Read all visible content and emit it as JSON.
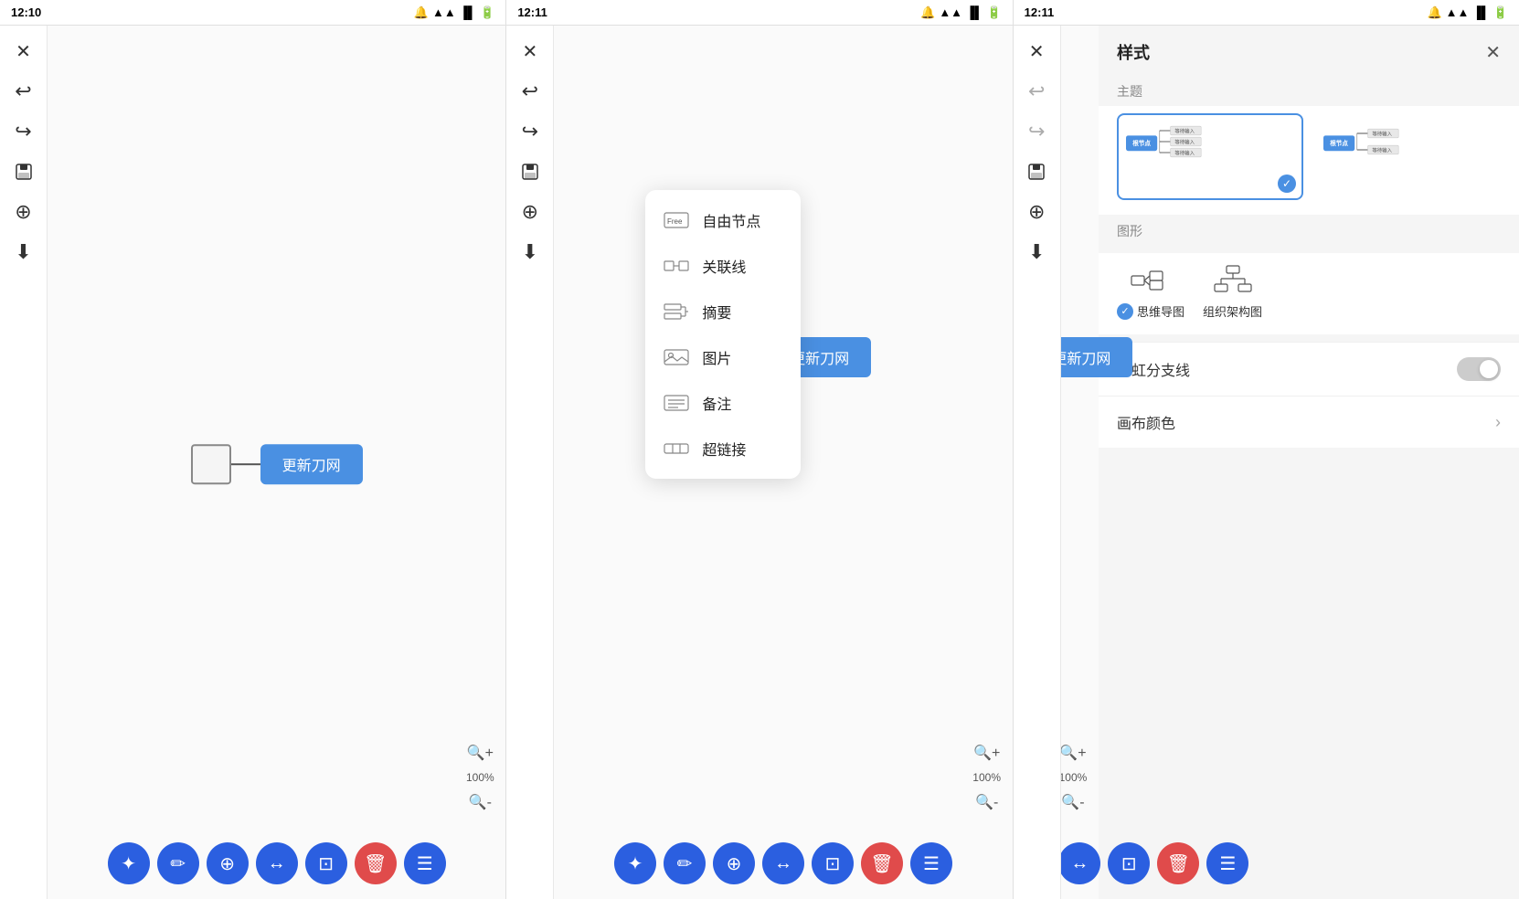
{
  "panels": [
    {
      "id": "panel1",
      "time": "12:10",
      "canvas_node_text": "更新刀网",
      "zoom": "100%"
    },
    {
      "id": "panel2",
      "time": "12:11",
      "canvas_node_text": "更新刀网",
      "zoom": "100%",
      "dropdown": {
        "items": [
          {
            "label": "自由节点",
            "icon": "free"
          },
          {
            "label": "关联线",
            "icon": "link"
          },
          {
            "label": "摘要",
            "icon": "summary"
          },
          {
            "label": "图片",
            "icon": "image"
          },
          {
            "label": "备注",
            "icon": "note"
          },
          {
            "label": "超链接",
            "icon": "hyperlink"
          }
        ]
      }
    },
    {
      "id": "panel3",
      "time": "12:11",
      "canvas_node_text": "更新刀网",
      "zoom": "100%",
      "style_panel": {
        "title": "样式",
        "sections": {
          "theme_label": "主题",
          "shape_label": "图形",
          "rainbow_label": "彩虹分支线",
          "canvas_color_label": "画布颜色"
        },
        "themes": [
          {
            "id": "theme1",
            "selected": true
          },
          {
            "id": "theme2",
            "selected": false
          }
        ],
        "shapes": [
          {
            "label": "思维导图",
            "selected": true
          },
          {
            "label": "组织架构图",
            "selected": false
          }
        ]
      }
    }
  ],
  "toolbar": {
    "close_label": "✕",
    "undo_label": "↩",
    "redo_label": "↪",
    "save_label": "💾",
    "add_label": "⊕",
    "download_label": "⬇"
  },
  "bottom_buttons": [
    {
      "icon": "✦",
      "type": "blue"
    },
    {
      "icon": "✏",
      "type": "blue"
    },
    {
      "icon": "⊕",
      "type": "blue"
    },
    {
      "icon": "↔",
      "type": "blue"
    },
    {
      "icon": "⊡",
      "type": "blue"
    },
    {
      "icon": "🗑",
      "type": "red"
    },
    {
      "icon": "☰",
      "type": "blue"
    }
  ]
}
